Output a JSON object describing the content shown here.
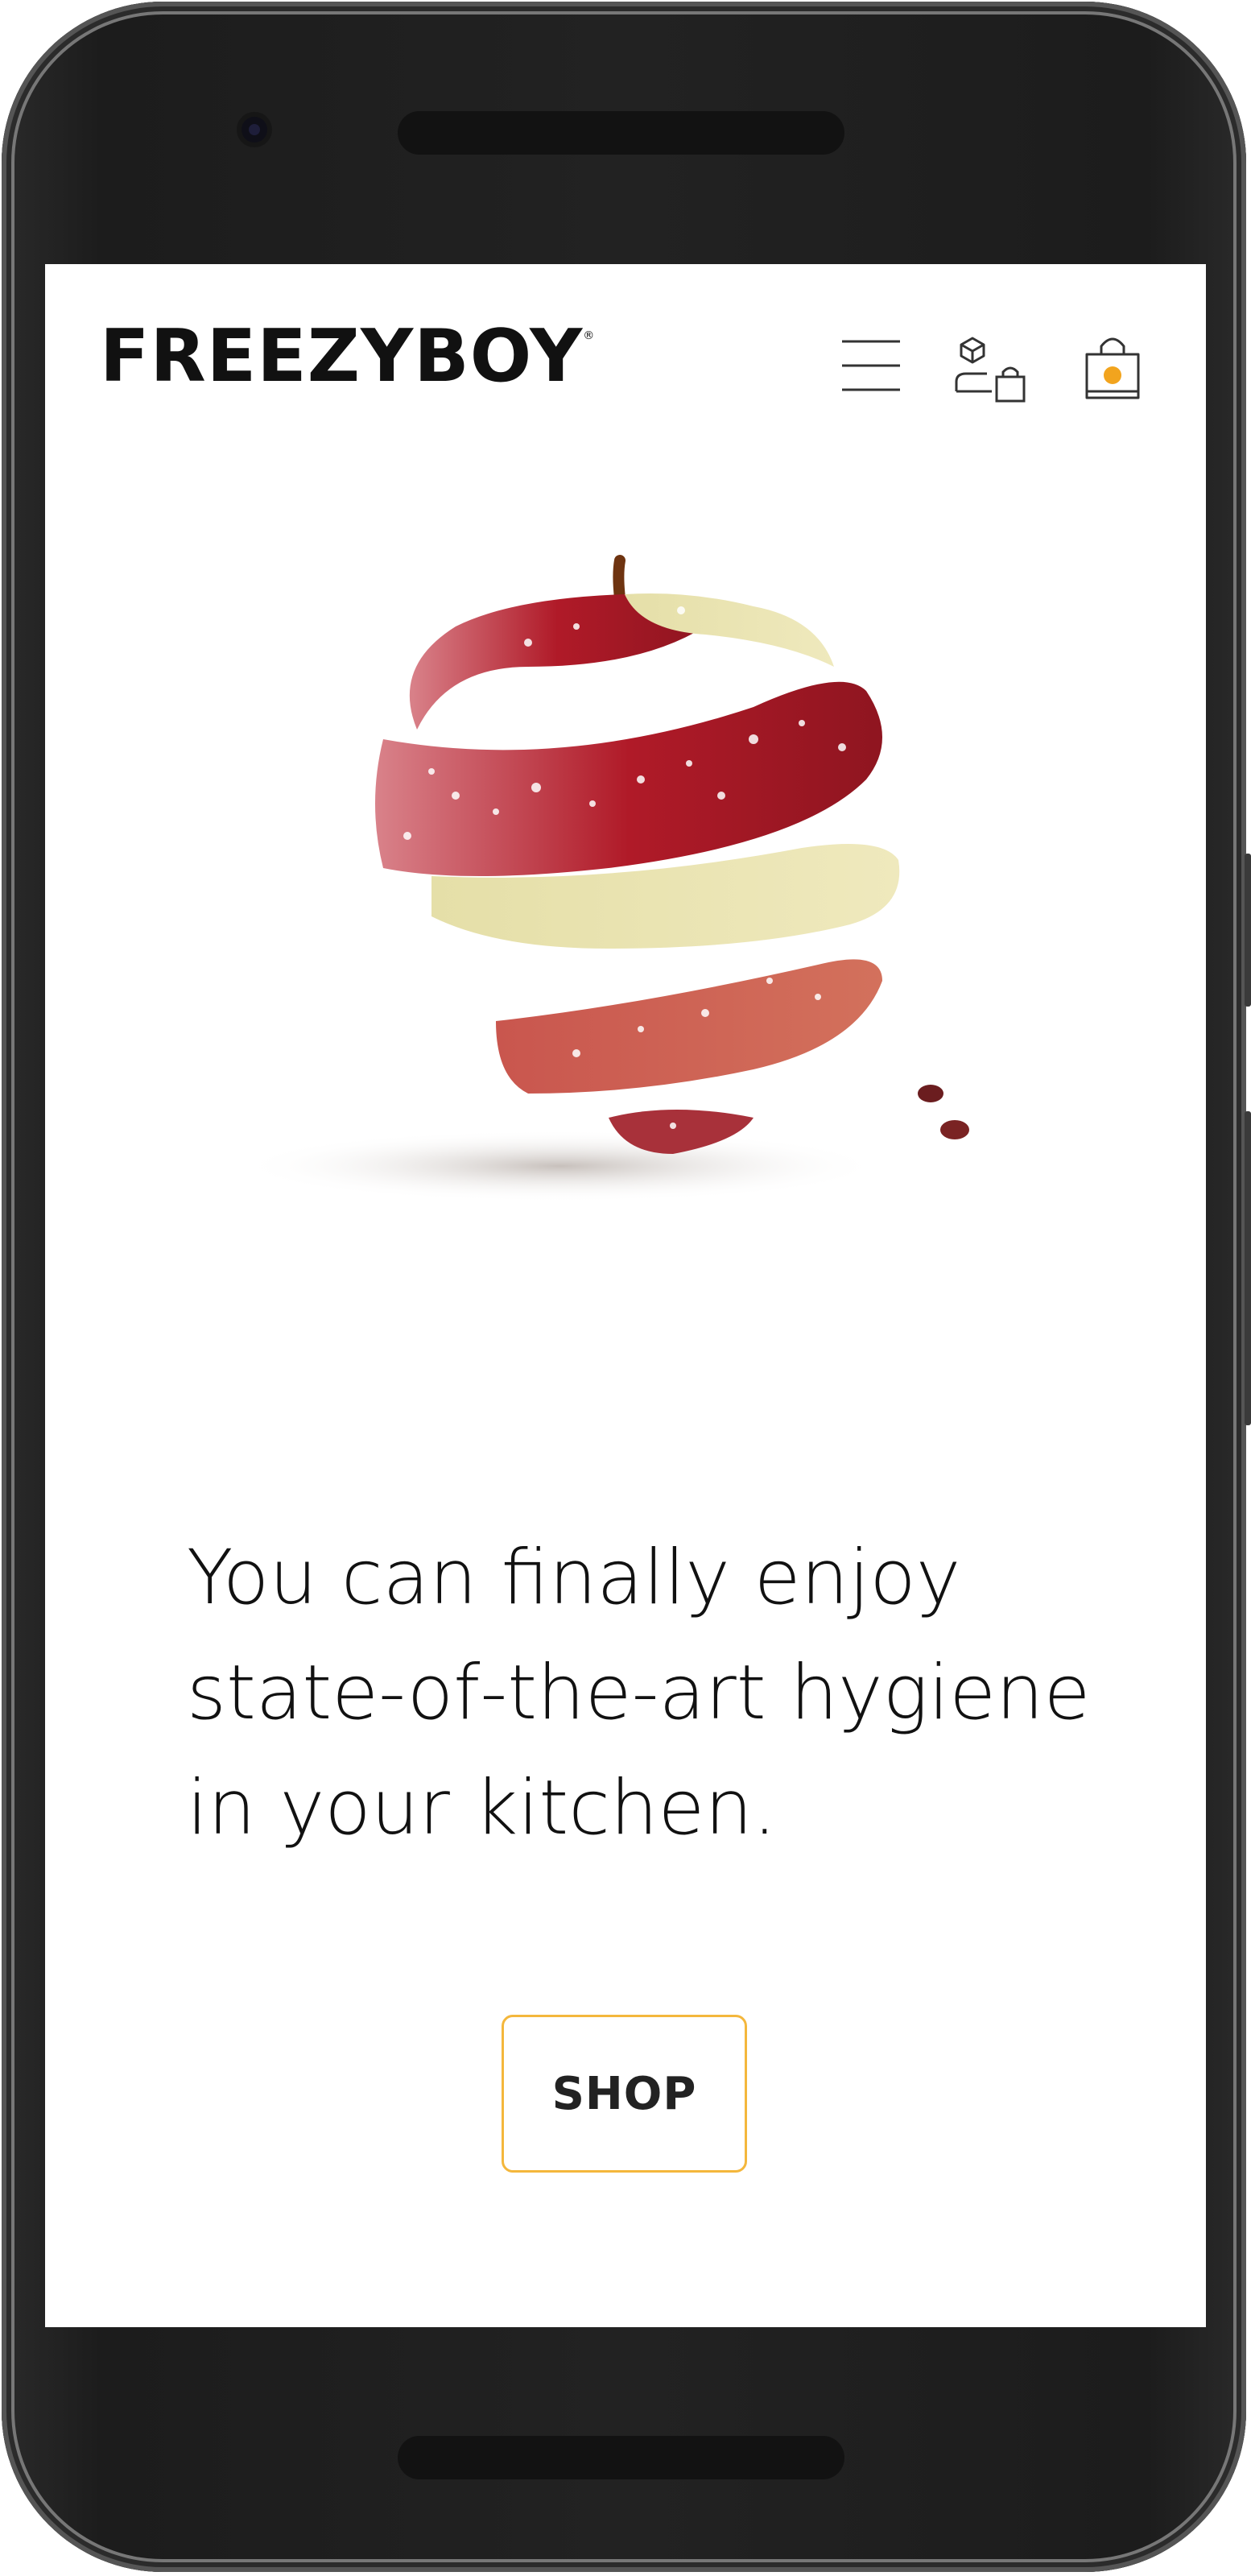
{
  "header": {
    "logo_text": "FREEZYBOY",
    "logo_mark": "®",
    "menu_icon": "hamburger-menu-icon",
    "account_icon": "account-shopping-icon",
    "cart_icon": "shopping-bag-icon"
  },
  "hero": {
    "image": "spiral-peeled-apple-with-frost"
  },
  "main": {
    "headline": "You can finally enjoy state-of-the-art hygiene in your kitchen.",
    "shop_label": "SHOP"
  },
  "colors": {
    "accent": "#f4b73c",
    "cart_dot": "#f2a41e",
    "text": "#111111",
    "apple_red": "#b21e2a",
    "apple_flesh": "#ece7b0"
  }
}
